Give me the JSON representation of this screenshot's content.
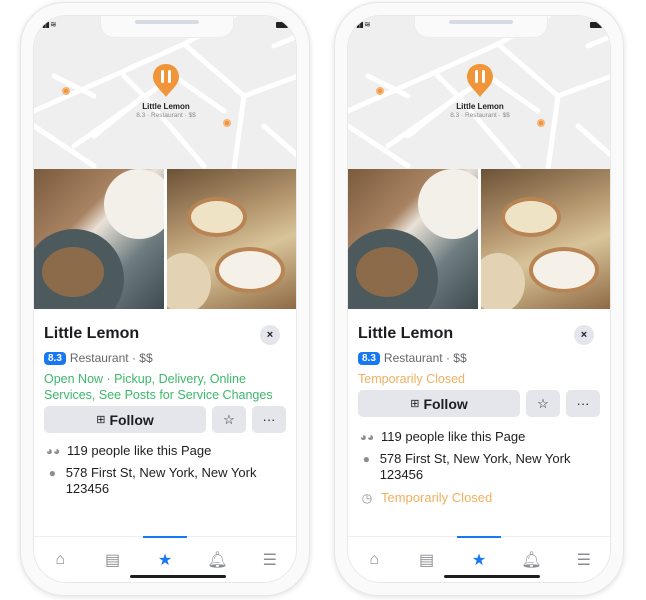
{
  "phones": [
    {
      "variant": "open",
      "map": {
        "pin_icon": "restaurant-pin-icon",
        "place_name": "Little Lemon",
        "place_sub": "8.3 · Restaurant · $$"
      },
      "page": {
        "title": "Little Lemon",
        "rating": "8.3",
        "category": "Restaurant · $$",
        "status_text": "Open Now · Pickup, Delivery, Online Services, See Posts for Service Changes",
        "follow_label": "Follow",
        "likes": "119 people like this Page",
        "address": "578 First St, New York, New York 123456"
      }
    },
    {
      "variant": "closed",
      "map": {
        "pin_icon": "restaurant-pin-icon",
        "place_name": "Little Lemon",
        "place_sub": "8.3 · Restaurant · $$"
      },
      "page": {
        "title": "Little Lemon",
        "rating": "8.3",
        "category": "Restaurant · $$",
        "status_text": "Temporarily Closed",
        "follow_label": "Follow",
        "likes": "119 people like this Page",
        "address": "578 First St, New York, New York 123456",
        "hours_status": "Temporarily Closed"
      }
    }
  ],
  "icons": {
    "close": "×",
    "star": "☆",
    "more": "···",
    "follow": "⊞",
    "likes": "👥",
    "location": "●",
    "clock": "◷"
  },
  "tabbar": [
    "home",
    "marketplace",
    "places",
    "notifications",
    "menu"
  ],
  "colors": {
    "accent": "#1877f2",
    "open_green": "#3cb86a",
    "closed_orange": "#f0b05f",
    "pin_orange": "#f0953a"
  }
}
